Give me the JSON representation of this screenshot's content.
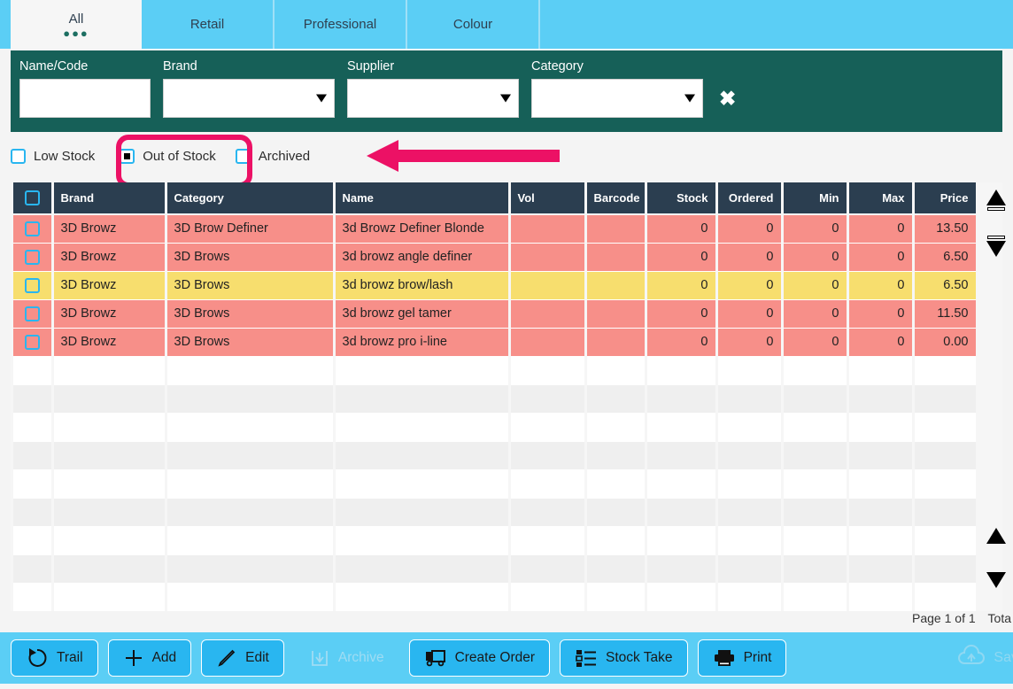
{
  "tabs": [
    {
      "label": "All",
      "active": true,
      "dots": "●●●"
    },
    {
      "label": "Retail",
      "active": false
    },
    {
      "label": "Professional",
      "active": false
    },
    {
      "label": "Colour",
      "active": false
    }
  ],
  "filters": {
    "name_code": {
      "label": "Name/Code",
      "value": "",
      "placeholder": ""
    },
    "brand": {
      "label": "Brand",
      "value": ""
    },
    "supplier": {
      "label": "Supplier",
      "value": ""
    },
    "category": {
      "label": "Category",
      "value": ""
    },
    "clear_icon": "✖"
  },
  "checkboxes": [
    {
      "label": "Low Stock",
      "checked": false
    },
    {
      "label": "Out of Stock",
      "checked": true
    },
    {
      "label": "Archived",
      "checked": false
    }
  ],
  "table": {
    "columns": [
      {
        "key": "select",
        "label": "",
        "align": "center"
      },
      {
        "key": "brand",
        "label": "Brand",
        "align": "left"
      },
      {
        "key": "category",
        "label": "Category",
        "align": "left"
      },
      {
        "key": "name",
        "label": "Name",
        "align": "left"
      },
      {
        "key": "vol",
        "label": "Vol",
        "align": "left"
      },
      {
        "key": "barcode",
        "label": "Barcode",
        "align": "left"
      },
      {
        "key": "stock",
        "label": "Stock",
        "align": "right"
      },
      {
        "key": "ordered",
        "label": "Ordered",
        "align": "right"
      },
      {
        "key": "min",
        "label": "Min",
        "align": "right"
      },
      {
        "key": "max",
        "label": "Max",
        "align": "right"
      },
      {
        "key": "price",
        "label": "Price",
        "align": "right"
      }
    ],
    "rows": [
      {
        "state": "out-of-stock",
        "brand": "3D Browz",
        "category": "3D Brow Definer",
        "name": "3d Browz Definer Blonde",
        "vol": "",
        "barcode": "",
        "stock": "0",
        "ordered": "0",
        "min": "0",
        "max": "0",
        "price": "13.50"
      },
      {
        "state": "out-of-stock",
        "brand": "3D Browz",
        "category": "3D Brows",
        "name": "3d browz angle definer",
        "vol": "",
        "barcode": "",
        "stock": "0",
        "ordered": "0",
        "min": "0",
        "max": "0",
        "price": "6.50"
      },
      {
        "state": "low-stock",
        "brand": "3D Browz",
        "category": "3D Brows",
        "name": "3d browz brow/lash",
        "vol": "",
        "barcode": "",
        "stock": "0",
        "ordered": "0",
        "min": "0",
        "max": "0",
        "price": "6.50"
      },
      {
        "state": "out-of-stock",
        "brand": "3D Browz",
        "category": "3D Brows",
        "name": "3d browz gel tamer",
        "vol": "",
        "barcode": "",
        "stock": "0",
        "ordered": "0",
        "min": "0",
        "max": "0",
        "price": "11.50"
      },
      {
        "state": "out-of-stock",
        "brand": "3D Browz",
        "category": "3D Brows",
        "name": "3d browz pro i-line",
        "vol": "",
        "barcode": "",
        "stock": "0",
        "ordered": "0",
        "min": "0",
        "max": "0",
        "price": "0.00"
      }
    ],
    "empty_row_count": 9
  },
  "side_controls": [
    {
      "name": "move-to-top",
      "glyph": "arrow-up-to-bar"
    },
    {
      "name": "move-to-bottom",
      "glyph": "arrow-down-to-bar"
    },
    {
      "name": "scroll-up",
      "glyph": "triangle-up"
    },
    {
      "name": "scroll-down",
      "glyph": "triangle-down"
    }
  ],
  "status": {
    "page": "Page 1 of 1",
    "total": "Tota"
  },
  "actions": [
    {
      "label": "Trail",
      "icon": "undo-icon",
      "disabled": false
    },
    {
      "label": "Add",
      "icon": "plus-icon",
      "disabled": false
    },
    {
      "label": "Edit",
      "icon": "pencil-icon",
      "disabled": false
    },
    {
      "label": "Archive",
      "icon": "archive-icon",
      "disabled": true
    },
    {
      "label": "Create Order",
      "icon": "truck-icon",
      "disabled": false
    },
    {
      "label": "Stock Take",
      "icon": "checklist-icon",
      "disabled": false
    },
    {
      "label": "Print",
      "icon": "printer-icon",
      "disabled": false
    }
  ],
  "save": {
    "label": "Sav",
    "icon": "cloud-upload-icon"
  },
  "colors": {
    "tab_bar": "#5BCEF5",
    "filter_bar": "#166058",
    "header_row": "#2b3e50",
    "out_of_stock_row": "#F78F89",
    "low_stock_row": "#F7DE6E",
    "accent_checkbox": "#29B6F0",
    "highlight_ring": "#EC1165",
    "annotation_arrow": "#EC1165",
    "dots": "#1D6F62"
  }
}
